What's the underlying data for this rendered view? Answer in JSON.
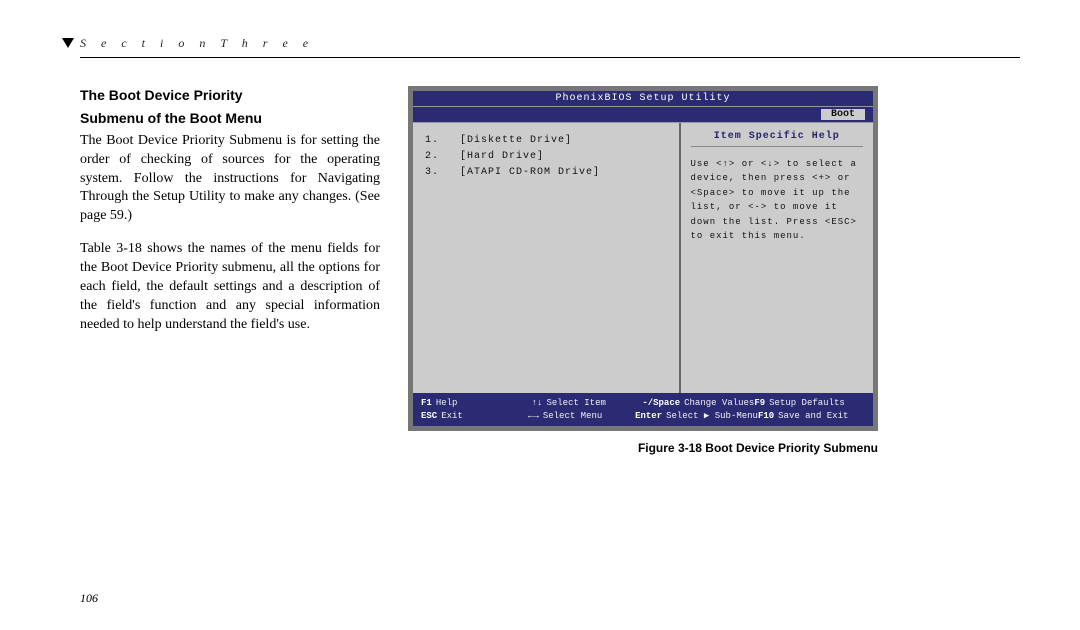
{
  "header": {
    "section_label": "S e c t i o n    T h r e e"
  },
  "article": {
    "heading_line1": "The Boot Device Priority",
    "heading_line2": "Submenu of the Boot Menu",
    "para1": "The Boot Device Priority Submenu is for setting the order of checking of sources for the operating system. Follow the instructions for Navigating Through the Setup Utility to make any changes. (See page 59.)",
    "para2": "Table 3-18 shows the names of the menu fields for the Boot Device Priority submenu, all the options for each field, the default settings and a description of the field's function and any special information needed to help understand the field's use."
  },
  "bios": {
    "title": "PhoenixBIOS Setup Utility",
    "active_tab": "Boot",
    "devices": [
      {
        "index": "1.",
        "label": "[Diskette Drive]"
      },
      {
        "index": "2.",
        "label": "[Hard Drive]"
      },
      {
        "index": "3.",
        "label": "[ATAPI CD-ROM Drive]"
      }
    ],
    "help": {
      "title": "Item Specific Help",
      "body": "Use <↑> or <↓> to select a device, then press <+> or <Space> to move it up the list, or <-> to move it down the list. Press <ESC> to exit this menu."
    },
    "footer": {
      "r1c1k": "F1",
      "r1c1t": "Help",
      "r1c2k": "↑↓",
      "r1c2t": "Select Item",
      "r1c3k": "-/Space",
      "r1c3t": "Change Values",
      "r1c4k": "F9",
      "r1c4t": "Setup Defaults",
      "r2c1k": "ESC",
      "r2c1t": "Exit",
      "r2c2k": "←→",
      "r2c2t": "Select Menu",
      "r2c3k": "Enter",
      "r2c3t": "Select ▶ Sub-Menu",
      "r2c4k": "F10",
      "r2c4t": "Save and Exit"
    }
  },
  "figure_caption": "Figure 3-18 Boot Device Priority Submenu",
  "page_number": "106"
}
